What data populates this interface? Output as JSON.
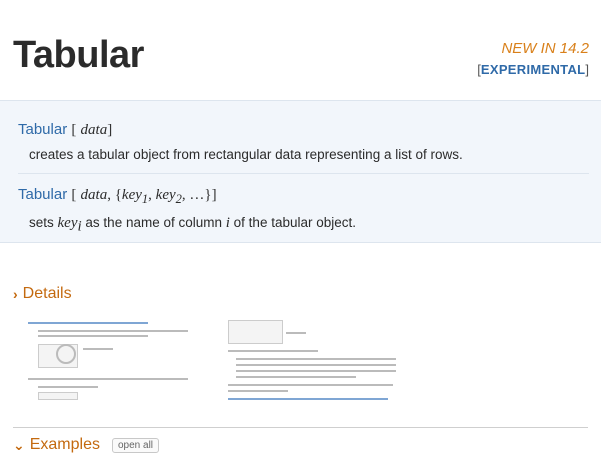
{
  "header": {
    "title": "Tabular",
    "new_in": "NEW IN 14.2",
    "experimental_open": "[",
    "experimental_label": "EXPERIMENTAL",
    "experimental_close": "]"
  },
  "usage": [
    {
      "function": "Tabular",
      "open": "[",
      "args": "data",
      "close": "]",
      "desc_before": "creates a tabular object from rectangular data representing a list of rows."
    },
    {
      "function": "Tabular",
      "open": "[",
      "args_a": "data",
      "args_b": ", {",
      "key1": "key",
      "key1_sub": "1",
      "key2": "key",
      "key2_sub": "2",
      "ellipsis": ", …}",
      "close": "]",
      "desc_1": "sets ",
      "desc_key": "key",
      "desc_key_sub": "i",
      "desc_2": " as the name of column ",
      "desc_i": "i",
      "desc_3": " of the tabular object."
    }
  ],
  "details": {
    "chevron": "›",
    "label": "Details"
  },
  "examples": {
    "chevron": "⌄",
    "label": "Examples",
    "open_all": "open all"
  },
  "colors": {
    "accent_orange": "#c46a10",
    "link_blue": "#2f6aa8",
    "usage_bg": "#f2f6fb"
  }
}
